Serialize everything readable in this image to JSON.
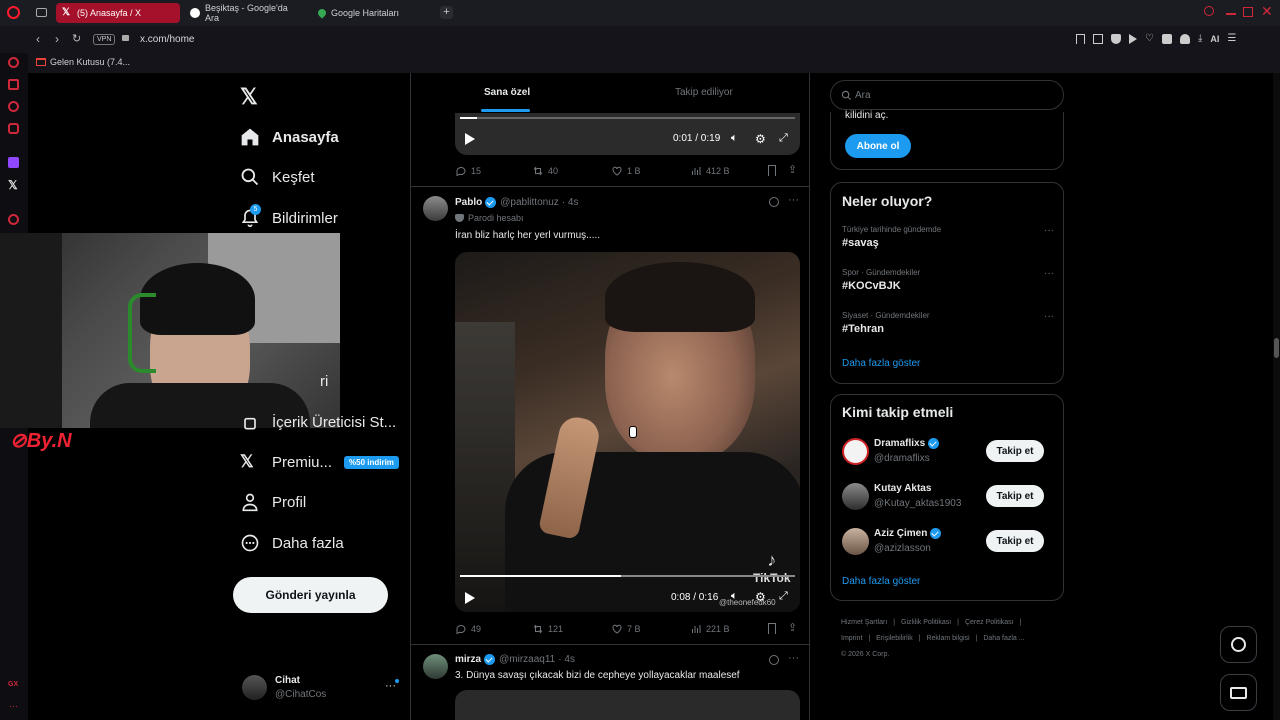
{
  "browser": {
    "tabs": [
      {
        "label": "(5) Anasayfa / X",
        "active": true
      },
      {
        "label": "Beşiktaş - Google'da Ara",
        "active": false
      },
      {
        "label": "Google Haritaları",
        "active": false
      }
    ],
    "vpn_label": "VPN",
    "url": "x.com/home",
    "ai_label": "AI",
    "bookmark": "Gelen Kutusu (7.4..."
  },
  "nav": {
    "items": [
      {
        "label": "Anasayfa",
        "icon": "home-icon"
      },
      {
        "label": "Keşfet",
        "icon": "search-icon"
      },
      {
        "label": "Bildirimler",
        "icon": "bell-icon",
        "badge": "5"
      },
      {
        "label": "ri",
        "icon": "list-icon"
      },
      {
        "label": "İçerik Üreticisi St...",
        "icon": "creator-icon"
      },
      {
        "label": "Premiu...",
        "icon": "x-logo-icon",
        "badge": "%50 indirim"
      },
      {
        "label": "Profil",
        "icon": "person-icon"
      },
      {
        "label": "Daha fazla",
        "icon": "more-circle-icon"
      }
    ],
    "post_button": "Gönderi yayınla",
    "account": {
      "name": "Cihat",
      "handle": "@CihatCos"
    }
  },
  "feed": {
    "tabs": [
      "Sana özel",
      "Takip ediliyor"
    ],
    "top_video": {
      "time": "0:01 / 0:19",
      "progress": 0.05
    },
    "top_stats": {
      "replies": "15",
      "reposts": "40",
      "likes": "1 B",
      "views": "412 B"
    },
    "posts": [
      {
        "name": "Pablo",
        "handle": "@pablittonuz",
        "age": "· 4s",
        "label": "Parodi hesabı",
        "text": "İran bliz harlç her yerl vurmuş.....",
        "video_time": "0:08 / 0:16",
        "video_progress": 0.48,
        "watermark": "TikTok",
        "watermark_user": "@theonefedk60",
        "stats": {
          "replies": "49",
          "reposts": "121",
          "likes": "7 B",
          "views": "221 B"
        }
      },
      {
        "name": "mirza",
        "handle": "@mirzaaq11",
        "age": "· 4s",
        "text": "3. Dünya savaşı çıkacak bizi de cepheye yollayacaklar maalesef"
      }
    ]
  },
  "right": {
    "search_placeholder": "Ara",
    "subscribe": {
      "partial_text": "kilidini aç.",
      "button": "Abone ol"
    },
    "trends": {
      "title": "Neler oluyor?",
      "items": [
        {
          "meta": "Türkiye tarihinde gündemde",
          "tag": "#savaş"
        },
        {
          "meta": "Spor · Gündemdekiler",
          "tag": "#KOCvBJK"
        },
        {
          "meta": "Siyaset · Gündemdekiler",
          "tag": "#Tehran"
        }
      ],
      "more": "Daha fazla göster"
    },
    "who_to_follow": {
      "title": "Kimi takip etmeli",
      "users": [
        {
          "name": "Dramaflixs",
          "handle": "@dramaflixs",
          "verified": true
        },
        {
          "name": "Kutay Aktas",
          "handle": "@Kutay_aktas1903",
          "verified": false
        },
        {
          "name": "Aziz Çimen",
          "handle": "@azizlasson",
          "verified": true
        }
      ],
      "follow_label": "Takip et",
      "more": "Daha fazla göster"
    },
    "footer": {
      "links": [
        "Hizmet Şartları",
        "Gizlilik Politikası",
        "Çerez Politikası",
        "Imprint",
        "Erişilebilirlik",
        "Reklam bilgisi",
        "Daha fazla ..."
      ],
      "copyright": "© 2026 X Corp."
    }
  },
  "colors": {
    "accent": "#1d9bf0",
    "background": "#000000",
    "border": "#2f3336",
    "muted": "#71767b"
  }
}
